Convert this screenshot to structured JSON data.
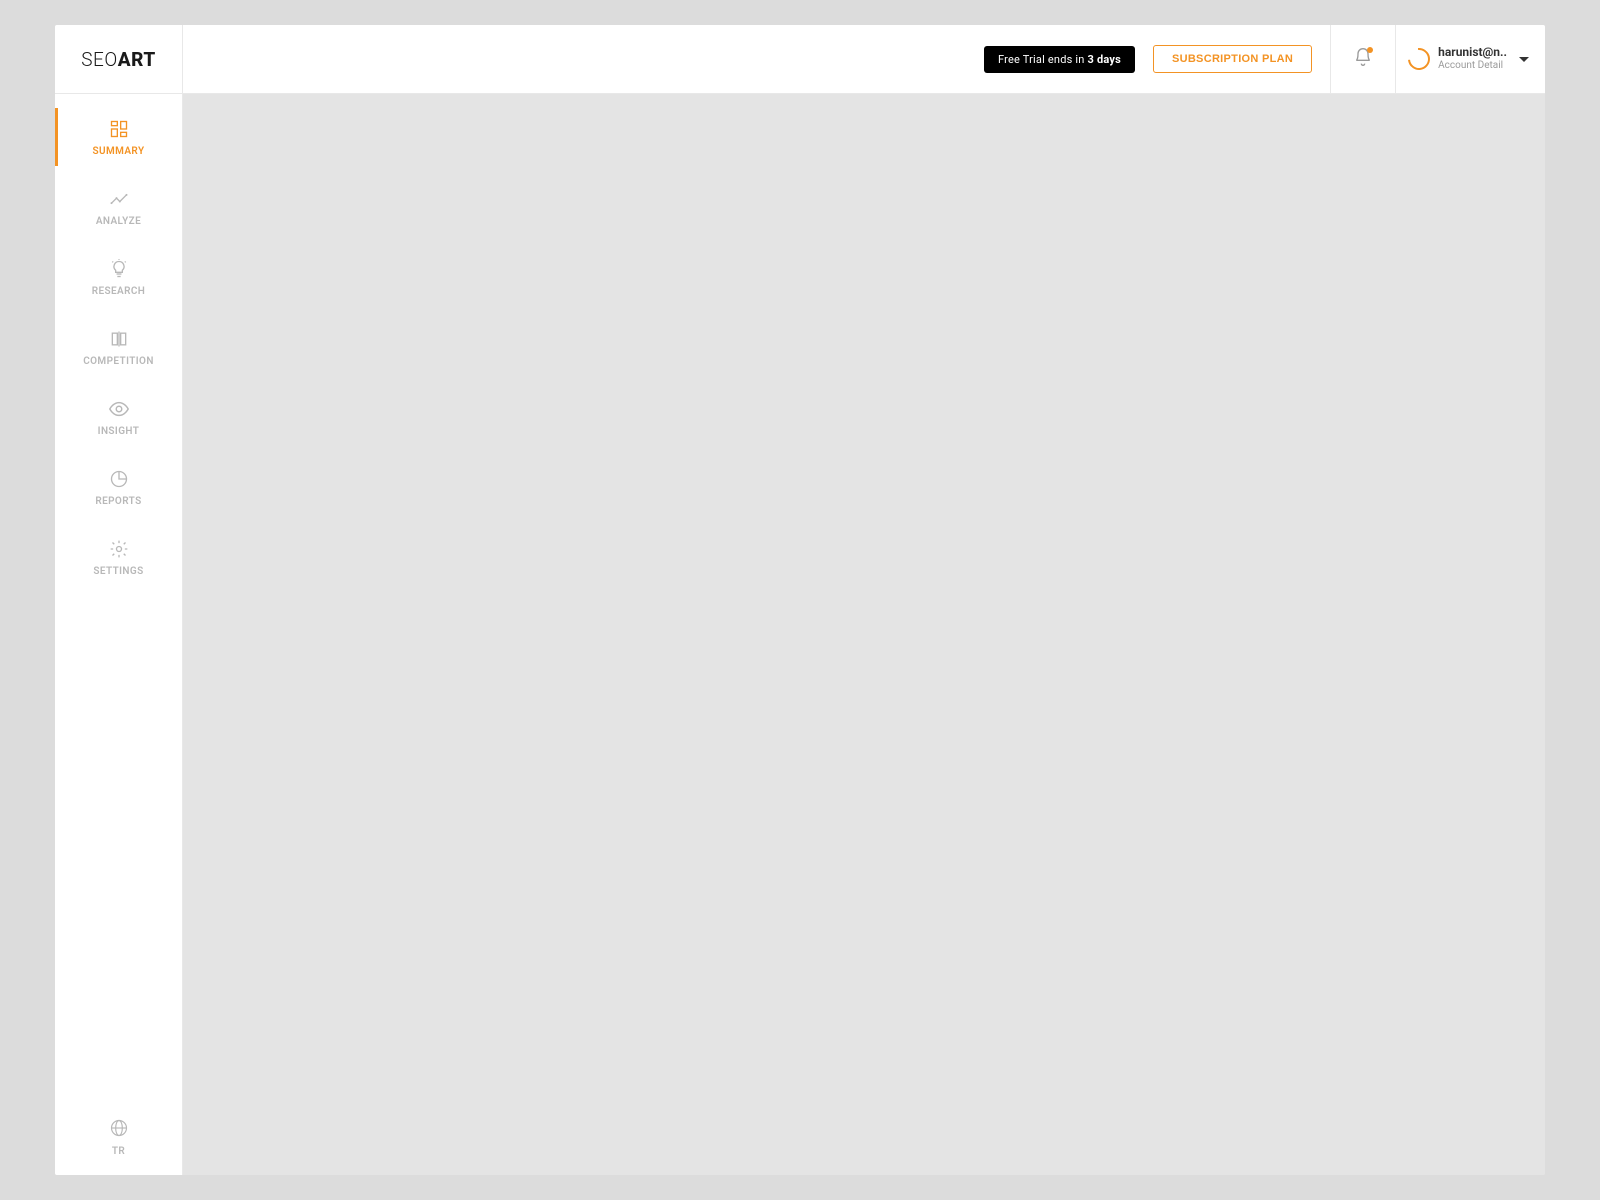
{
  "brand": {
    "part1": "SEO",
    "part2": "ART"
  },
  "header": {
    "trial_prefix": "Free Trial ends in ",
    "trial_bold": "3 days",
    "subscription_label": "SUBSCRIPTION PLAN",
    "account_name": "harunist@n..",
    "account_sub": "Account Detail"
  },
  "sidebar": {
    "items": [
      {
        "label": "SUMMARY",
        "icon": "grid",
        "active": true
      },
      {
        "label": "ANALYZE",
        "icon": "trend",
        "active": false
      },
      {
        "label": "RESEARCH",
        "icon": "bulb",
        "active": false
      },
      {
        "label": "COMPETITION",
        "icon": "compare",
        "active": false
      },
      {
        "label": "INSIGHT",
        "icon": "eye",
        "active": false
      },
      {
        "label": "REPORTS",
        "icon": "piechart",
        "active": false
      },
      {
        "label": "SETTINGS",
        "icon": "gear",
        "active": false
      }
    ],
    "language": "TR"
  },
  "colors": {
    "accent": "#f39324",
    "muted": "#b8b8b8",
    "background": "#dcdcdc"
  }
}
